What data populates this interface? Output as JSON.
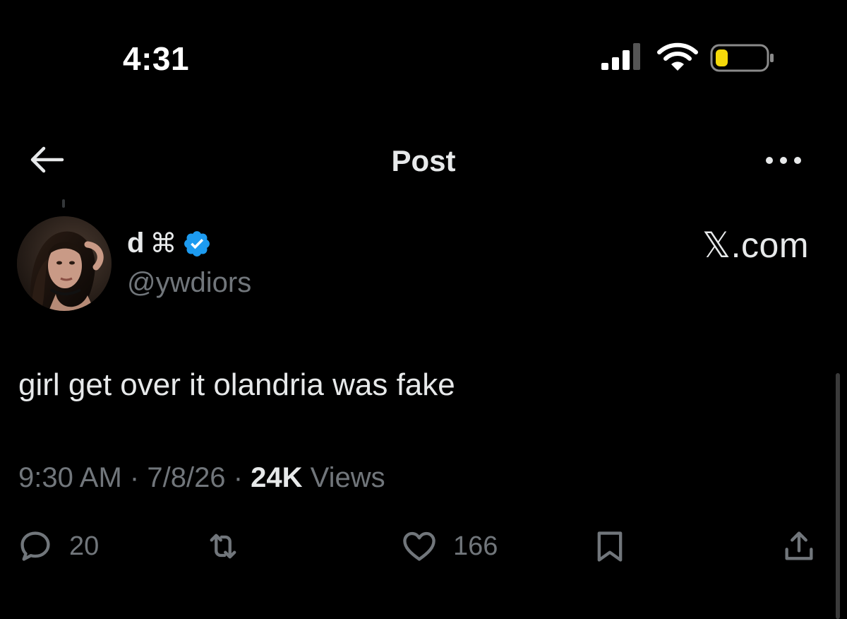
{
  "status_bar": {
    "time": "4:31",
    "signal_icon": "cellular-signal-icon",
    "wifi_icon": "wifi-icon",
    "battery_icon": "battery-low-icon",
    "battery_level": 0.25,
    "battery_color": "#f5d90a"
  },
  "nav": {
    "title": "Post",
    "back_icon": "back-arrow-icon",
    "more_icon": "more-dots-icon"
  },
  "author": {
    "display_name": "d",
    "name_symbol": "⌘",
    "verified": true,
    "verified_color": "#1d9bf0",
    "handle": "@ywdiors"
  },
  "watermark": "𝕏.com",
  "tweet": {
    "text": "girl get over it olandria was fake",
    "time": "9:30 AM",
    "date": "7/8/26",
    "separator": "·",
    "views_count": "24K",
    "views_label": "Views"
  },
  "actions": {
    "replies": "20",
    "likes": "166"
  },
  "colors": {
    "background": "#000000",
    "text": "#e7e9ea",
    "secondary": "#71767b",
    "accent": "#1d9bf0"
  }
}
